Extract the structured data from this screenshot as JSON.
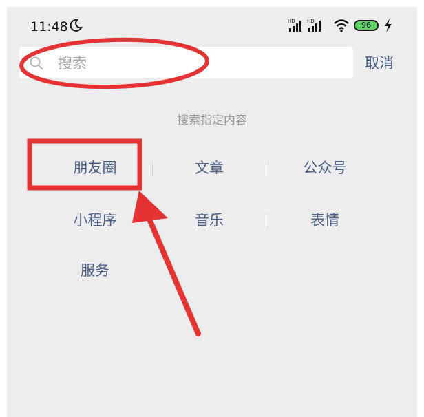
{
  "status_bar": {
    "time": "11:48",
    "battery": "96",
    "icons": [
      "moon-icon",
      "hd-signal-icon",
      "hd-signal-icon",
      "wifi-icon",
      "battery-icon",
      "charging-icon"
    ]
  },
  "search": {
    "placeholder": "搜索",
    "cancel_label": "取消"
  },
  "content": {
    "section_title": "搜索指定内容",
    "options": [
      "朋友圈",
      "文章",
      "公众号",
      "小程序",
      "音乐",
      "表情",
      "服务"
    ]
  },
  "colors": {
    "background": "#ededed",
    "link_text": "#4a5f86",
    "hint_text": "#9c9c9c",
    "annotation_red": "#e53232",
    "battery_green": "#5fd35f"
  }
}
